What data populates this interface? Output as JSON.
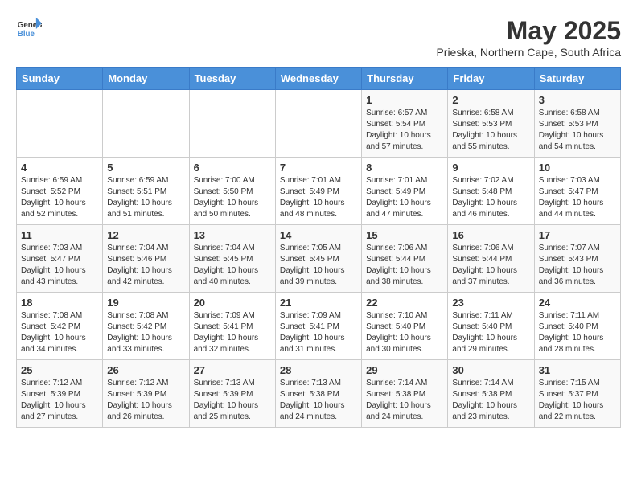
{
  "header": {
    "logo_text_general": "General",
    "logo_text_blue": "Blue",
    "month_title": "May 2025",
    "location": "Prieska, Northern Cape, South Africa"
  },
  "days_of_week": [
    "Sunday",
    "Monday",
    "Tuesday",
    "Wednesday",
    "Thursday",
    "Friday",
    "Saturday"
  ],
  "weeks": [
    [
      null,
      null,
      null,
      null,
      {
        "day": "1",
        "sunrise": "6:57 AM",
        "sunset": "5:54 PM",
        "daylight": "10 hours and 57 minutes."
      },
      {
        "day": "2",
        "sunrise": "6:58 AM",
        "sunset": "5:53 PM",
        "daylight": "10 hours and 55 minutes."
      },
      {
        "day": "3",
        "sunrise": "6:58 AM",
        "sunset": "5:53 PM",
        "daylight": "10 hours and 54 minutes."
      }
    ],
    [
      {
        "day": "4",
        "sunrise": "6:59 AM",
        "sunset": "5:52 PM",
        "daylight": "10 hours and 52 minutes."
      },
      {
        "day": "5",
        "sunrise": "6:59 AM",
        "sunset": "5:51 PM",
        "daylight": "10 hours and 51 minutes."
      },
      {
        "day": "6",
        "sunrise": "7:00 AM",
        "sunset": "5:50 PM",
        "daylight": "10 hours and 50 minutes."
      },
      {
        "day": "7",
        "sunrise": "7:01 AM",
        "sunset": "5:49 PM",
        "daylight": "10 hours and 48 minutes."
      },
      {
        "day": "8",
        "sunrise": "7:01 AM",
        "sunset": "5:49 PM",
        "daylight": "10 hours and 47 minutes."
      },
      {
        "day": "9",
        "sunrise": "7:02 AM",
        "sunset": "5:48 PM",
        "daylight": "10 hours and 46 minutes."
      },
      {
        "day": "10",
        "sunrise": "7:03 AM",
        "sunset": "5:47 PM",
        "daylight": "10 hours and 44 minutes."
      }
    ],
    [
      {
        "day": "11",
        "sunrise": "7:03 AM",
        "sunset": "5:47 PM",
        "daylight": "10 hours and 43 minutes."
      },
      {
        "day": "12",
        "sunrise": "7:04 AM",
        "sunset": "5:46 PM",
        "daylight": "10 hours and 42 minutes."
      },
      {
        "day": "13",
        "sunrise": "7:04 AM",
        "sunset": "5:45 PM",
        "daylight": "10 hours and 40 minutes."
      },
      {
        "day": "14",
        "sunrise": "7:05 AM",
        "sunset": "5:45 PM",
        "daylight": "10 hours and 39 minutes."
      },
      {
        "day": "15",
        "sunrise": "7:06 AM",
        "sunset": "5:44 PM",
        "daylight": "10 hours and 38 minutes."
      },
      {
        "day": "16",
        "sunrise": "7:06 AM",
        "sunset": "5:44 PM",
        "daylight": "10 hours and 37 minutes."
      },
      {
        "day": "17",
        "sunrise": "7:07 AM",
        "sunset": "5:43 PM",
        "daylight": "10 hours and 36 minutes."
      }
    ],
    [
      {
        "day": "18",
        "sunrise": "7:08 AM",
        "sunset": "5:42 PM",
        "daylight": "10 hours and 34 minutes."
      },
      {
        "day": "19",
        "sunrise": "7:08 AM",
        "sunset": "5:42 PM",
        "daylight": "10 hours and 33 minutes."
      },
      {
        "day": "20",
        "sunrise": "7:09 AM",
        "sunset": "5:41 PM",
        "daylight": "10 hours and 32 minutes."
      },
      {
        "day": "21",
        "sunrise": "7:09 AM",
        "sunset": "5:41 PM",
        "daylight": "10 hours and 31 minutes."
      },
      {
        "day": "22",
        "sunrise": "7:10 AM",
        "sunset": "5:40 PM",
        "daylight": "10 hours and 30 minutes."
      },
      {
        "day": "23",
        "sunrise": "7:11 AM",
        "sunset": "5:40 PM",
        "daylight": "10 hours and 29 minutes."
      },
      {
        "day": "24",
        "sunrise": "7:11 AM",
        "sunset": "5:40 PM",
        "daylight": "10 hours and 28 minutes."
      }
    ],
    [
      {
        "day": "25",
        "sunrise": "7:12 AM",
        "sunset": "5:39 PM",
        "daylight": "10 hours and 27 minutes."
      },
      {
        "day": "26",
        "sunrise": "7:12 AM",
        "sunset": "5:39 PM",
        "daylight": "10 hours and 26 minutes."
      },
      {
        "day": "27",
        "sunrise": "7:13 AM",
        "sunset": "5:39 PM",
        "daylight": "10 hours and 25 minutes."
      },
      {
        "day": "28",
        "sunrise": "7:13 AM",
        "sunset": "5:38 PM",
        "daylight": "10 hours and 24 minutes."
      },
      {
        "day": "29",
        "sunrise": "7:14 AM",
        "sunset": "5:38 PM",
        "daylight": "10 hours and 24 minutes."
      },
      {
        "day": "30",
        "sunrise": "7:14 AM",
        "sunset": "5:38 PM",
        "daylight": "10 hours and 23 minutes."
      },
      {
        "day": "31",
        "sunrise": "7:15 AM",
        "sunset": "5:37 PM",
        "daylight": "10 hours and 22 minutes."
      }
    ]
  ],
  "labels": {
    "sunrise_prefix": "Sunrise: ",
    "sunset_prefix": "Sunset: ",
    "daylight_prefix": "Daylight: "
  }
}
